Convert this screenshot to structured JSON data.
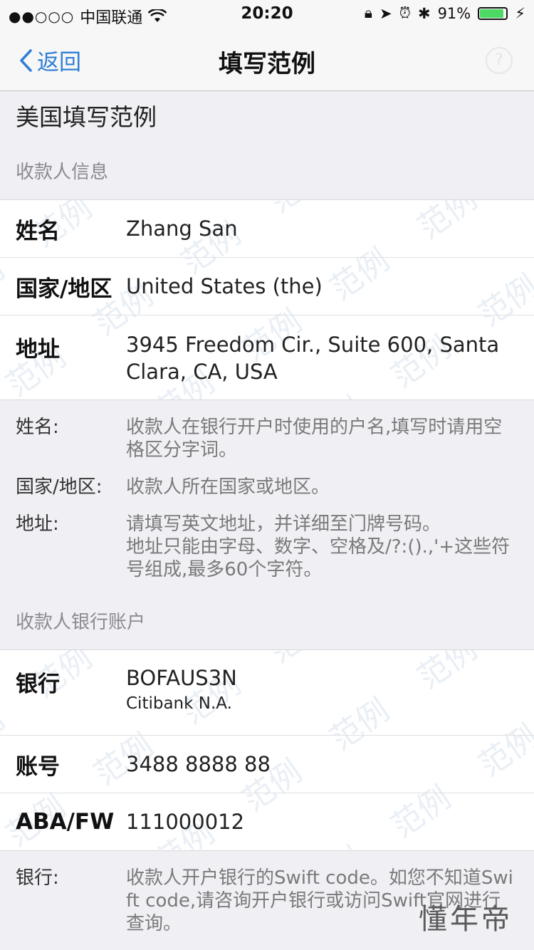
{
  "status": {
    "carrier": "中国联通",
    "time": "20:20",
    "battery": "91%",
    "battery_level": 0.91
  },
  "nav": {
    "back_label": "返回",
    "title": "填写范例",
    "help": "?"
  },
  "page": {
    "heading": "美国填写范例"
  },
  "payee": {
    "section_title": "收款人信息",
    "rows": [
      {
        "label": "姓名",
        "value": "Zhang San"
      },
      {
        "label": "国家/地区",
        "value": "United States (the)"
      },
      {
        "label": "地址",
        "value": "3945 Freedom Cir., Suite 600, Santa Clara, CA, USA"
      }
    ],
    "notes": [
      {
        "label": "姓名:",
        "text": "收款人在银行开户时使用的户名,填写时请用空格区分字词。"
      },
      {
        "label": "国家/地区:",
        "text": "收款人所在国家或地区。"
      },
      {
        "label": "地址:",
        "text": "请填写英文地址，并详细至门牌号码。",
        "text2": "地址只能由字母、数字、空格及/?:().,'+这些符号组成,最多60个字符。"
      }
    ]
  },
  "bank": {
    "section_title": "收款人银行账户",
    "rows": [
      {
        "label": "银行",
        "value": "BOFAUS3N",
        "sub": "Citibank N.A."
      },
      {
        "label": "账号",
        "value": "3488 8888 88"
      },
      {
        "label": "ABA/FW",
        "value": "111000012"
      }
    ],
    "notes": [
      {
        "label": "银行:",
        "text": "收款人开户银行的Swift code。如您不知道Swift code,请咨询开户银行或访问Swift官网进行查询。"
      }
    ]
  },
  "watermark_text": "范例",
  "brand_watermark": "懂年帝"
}
